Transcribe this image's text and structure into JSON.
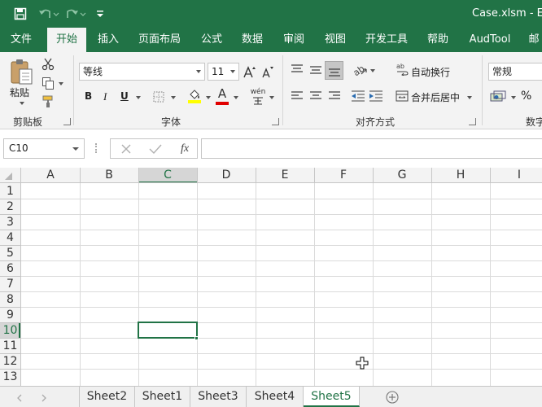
{
  "app": {
    "title": "Case.xlsm - E",
    "accent": "#217346"
  },
  "quick_access": [
    "save-icon",
    "undo-icon",
    "redo-icon",
    "customize-icon"
  ],
  "tabs": [
    {
      "label": "文件"
    },
    {
      "label": "开始",
      "active": true
    },
    {
      "label": "插入"
    },
    {
      "label": "页面布局"
    },
    {
      "label": "公式"
    },
    {
      "label": "数据"
    },
    {
      "label": "审阅"
    },
    {
      "label": "视图"
    },
    {
      "label": "开发工具"
    },
    {
      "label": "帮助"
    },
    {
      "label": "AudTool"
    },
    {
      "label": "邮"
    }
  ],
  "ribbon": {
    "clipboard": {
      "paste_label": "粘贴",
      "group_label": "剪贴板"
    },
    "font": {
      "font_name": "等线",
      "font_size": "11",
      "group_label": "字体",
      "bold": "B",
      "italic": "I",
      "underline": "U",
      "font_color": "A",
      "pinyin": "wén"
    },
    "alignment": {
      "wrap_text": "自动换行",
      "merge_center": "合并后居中",
      "group_label": "对齐方式"
    },
    "number": {
      "format": "常规",
      "percent": "%",
      "group_label": "数字"
    }
  },
  "formula_bar": {
    "name_box": "C10",
    "fx": "fx",
    "content": ""
  },
  "grid": {
    "columns": [
      "A",
      "B",
      "C",
      "D",
      "E",
      "F",
      "G",
      "H",
      "I"
    ],
    "rows": [
      "1",
      "2",
      "3",
      "4",
      "5",
      "6",
      "7",
      "8",
      "9",
      "10",
      "11",
      "12",
      "13"
    ],
    "active_column": "C",
    "active_row": "10"
  },
  "sheets": [
    {
      "label": "Sheet2"
    },
    {
      "label": "Sheet1"
    },
    {
      "label": "Sheet3"
    },
    {
      "label": "Sheet4"
    },
    {
      "label": "Sheet5",
      "active": true
    }
  ]
}
